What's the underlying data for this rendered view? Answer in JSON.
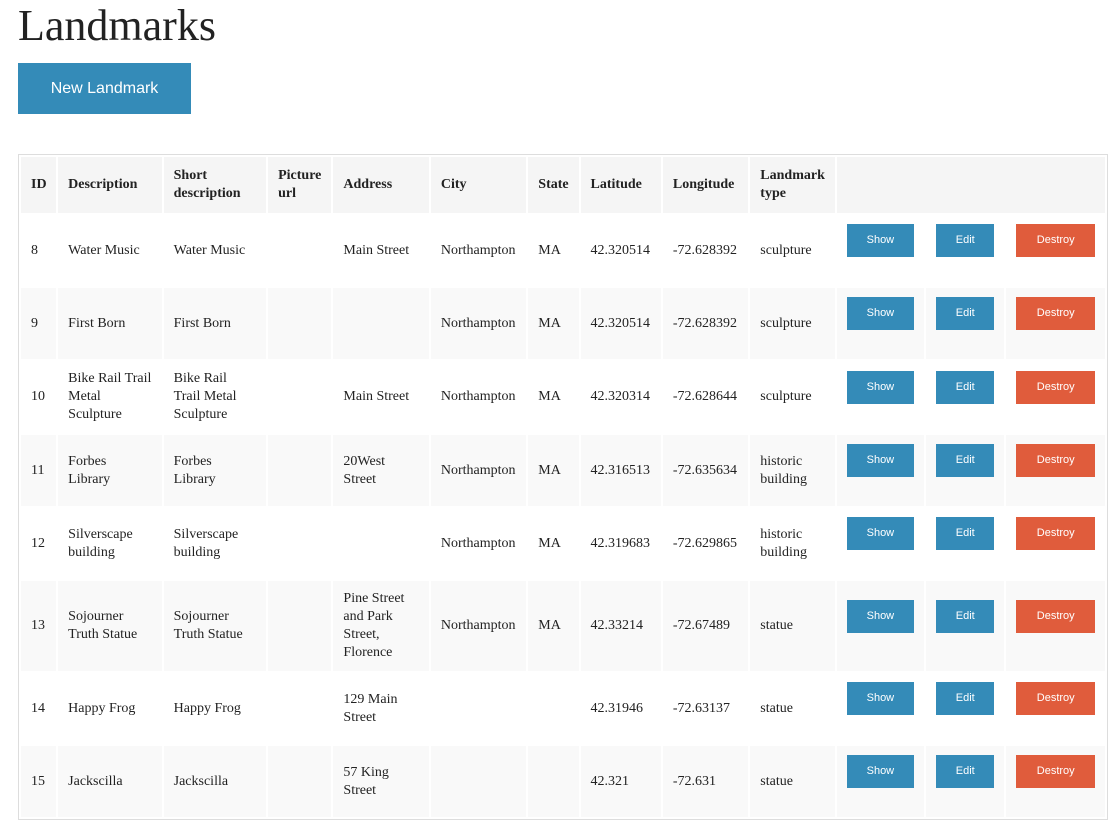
{
  "page": {
    "title": "Landmarks",
    "new_button": "New Landmark"
  },
  "colors": {
    "primary": "#348bb8",
    "danger": "#e05c3c"
  },
  "table": {
    "headers": [
      "ID",
      "Description",
      "Short description",
      "Picture url",
      "Address",
      "City",
      "State",
      "Latitude",
      "Longitude",
      "Landmark type"
    ],
    "actions": {
      "show": "Show",
      "edit": "Edit",
      "destroy": "Destroy"
    },
    "rows": [
      {
        "id": "8",
        "description": "Water Music",
        "short_description": "Water Music",
        "picture_url": "",
        "address": "Main Street",
        "city": "Northampton",
        "state": "MA",
        "latitude": "42.320514",
        "longitude": "-72.628392",
        "landmark_type": "sculpture"
      },
      {
        "id": "9",
        "description": "First Born",
        "short_description": "First Born",
        "picture_url": "",
        "address": "",
        "city": "Northampton",
        "state": "MA",
        "latitude": "42.320514",
        "longitude": "-72.628392",
        "landmark_type": "sculpture"
      },
      {
        "id": "10",
        "description": "Bike Rail Trail Metal Sculpture",
        "short_description": "Bike Rail Trail Metal Sculpture",
        "picture_url": "",
        "address": "Main Street",
        "city": "Northampton",
        "state": "MA",
        "latitude": "42.320314",
        "longitude": "-72.628644",
        "landmark_type": "sculpture"
      },
      {
        "id": "11",
        "description": "Forbes Library",
        "short_description": "Forbes Library",
        "picture_url": "",
        "address": "20West Street",
        "city": "Northampton",
        "state": "MA",
        "latitude": "42.316513",
        "longitude": "-72.635634",
        "landmark_type": "historic building"
      },
      {
        "id": "12",
        "description": "Silverscape building",
        "short_description": "Silverscape building",
        "picture_url": "",
        "address": "",
        "city": "Northampton",
        "state": "MA",
        "latitude": "42.319683",
        "longitude": "-72.629865",
        "landmark_type": "historic building"
      },
      {
        "id": "13",
        "description": "Sojourner Truth Statue",
        "short_description": "Sojourner Truth Statue",
        "picture_url": "",
        "address": "Pine Street and Park Street, Florence",
        "city": "Northampton",
        "state": "MA",
        "latitude": "42.33214",
        "longitude": "-72.67489",
        "landmark_type": "statue"
      },
      {
        "id": "14",
        "description": "Happy Frog",
        "short_description": "Happy Frog",
        "picture_url": "",
        "address": "129 Main Street",
        "city": "",
        "state": "",
        "latitude": "42.31946",
        "longitude": "-72.63137",
        "landmark_type": "statue"
      },
      {
        "id": "15",
        "description": "Jackscilla",
        "short_description": "Jackscilla",
        "picture_url": "",
        "address": "57 King Street",
        "city": "",
        "state": "",
        "latitude": "42.321",
        "longitude": "-72.631",
        "landmark_type": "statue"
      }
    ]
  }
}
